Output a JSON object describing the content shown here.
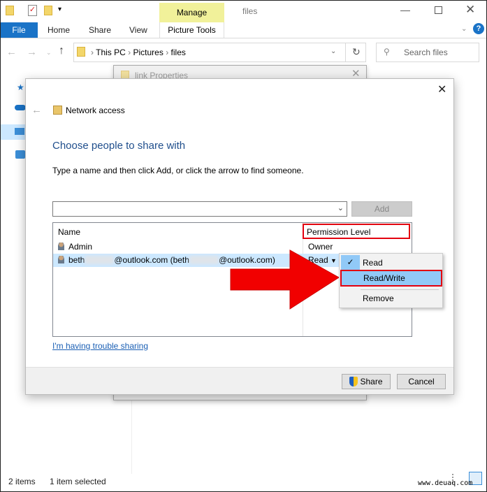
{
  "window": {
    "title": "files",
    "contextual_tab": "Manage",
    "contextual_group": "Picture Tools"
  },
  "ribbon": {
    "tabs": [
      "File",
      "Home",
      "Share",
      "View"
    ]
  },
  "address": {
    "crumbs": [
      "This PC",
      "Pictures",
      "files"
    ]
  },
  "search": {
    "placeholder": "Search files"
  },
  "background_dialog": {
    "title": "link Properties"
  },
  "dialog": {
    "title": "Network access",
    "heading": "Choose people to share with",
    "instruction": "Type a name and then click Add, or click the arrow to find someone.",
    "name_input": {
      "value": "",
      "placeholder": ""
    },
    "add_label": "Add",
    "columns": [
      "Name",
      "Permission Level"
    ],
    "rows": [
      {
        "name": "Admin",
        "permission": "Owner"
      },
      {
        "name_prefix": "beth",
        "name_mid": "@outlook.com (beth",
        "name_suffix": "@outlook.com)",
        "permission": "Read"
      }
    ],
    "menu": {
      "items": [
        "Read",
        "Read/Write",
        "Remove"
      ],
      "checked": "Read",
      "highlighted": "Read/Write"
    },
    "trouble_link": "I'm having trouble sharing",
    "share_label": "Share",
    "cancel_label": "Cancel"
  },
  "status": {
    "items": "2 items",
    "selected": "1 item selected"
  },
  "watermark": "www.deuaq.com",
  "colors": {
    "accent": "#1a73c7",
    "heading": "#1f4e8c",
    "highlight_red": "#e3000f",
    "selection": "#cce8ff",
    "menu_highlight": "#91c9f7"
  }
}
